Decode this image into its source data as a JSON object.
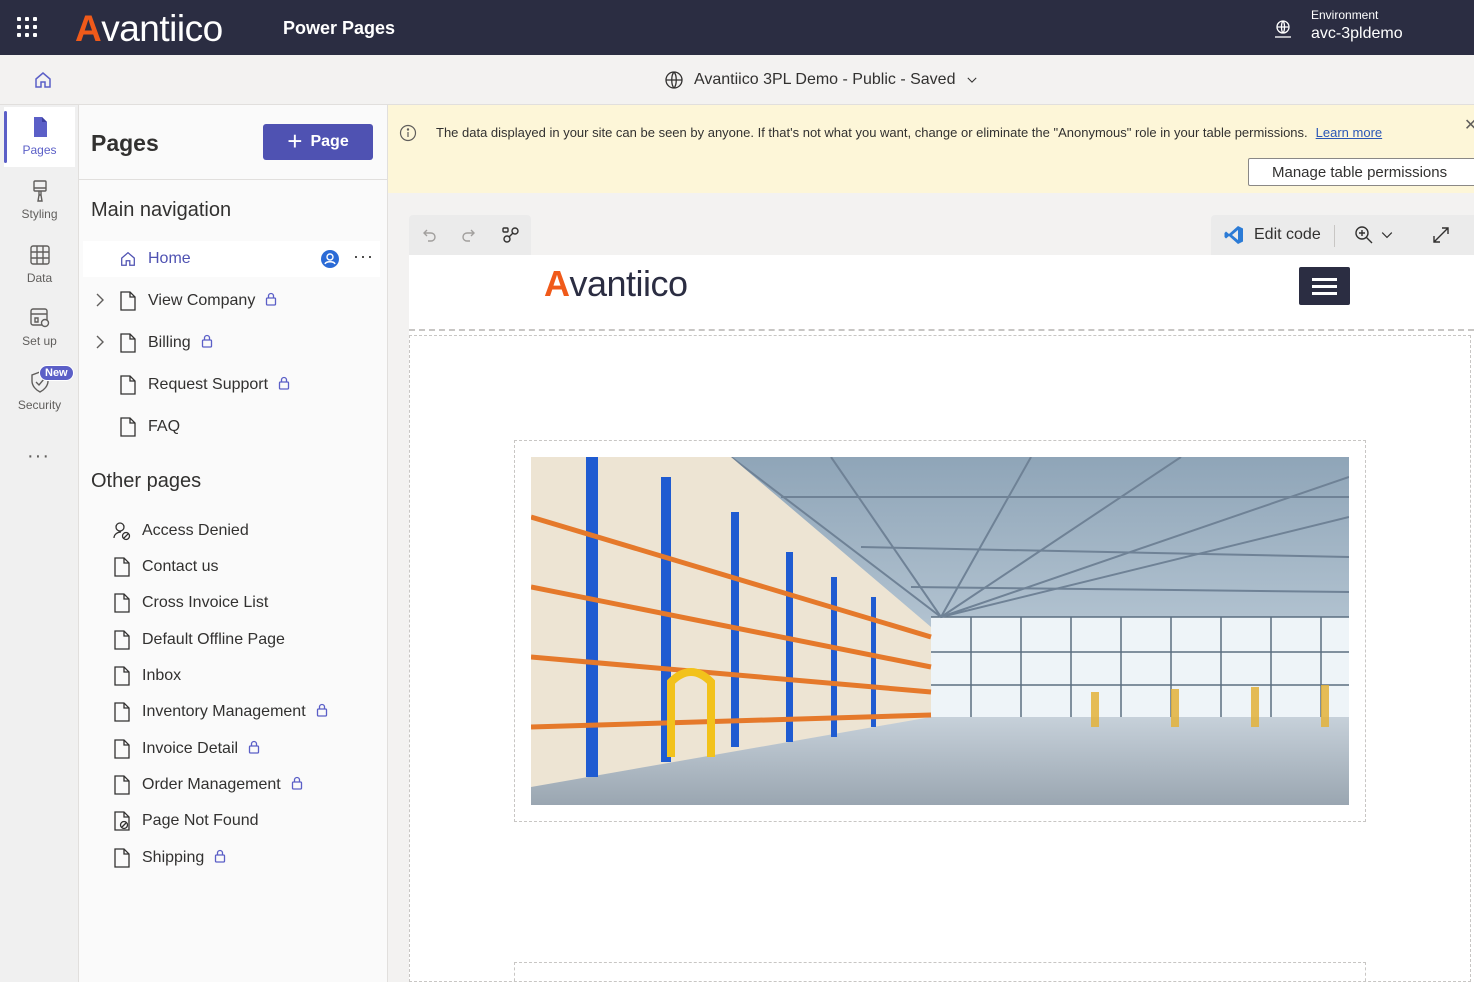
{
  "topbar": {
    "brand_a": "A",
    "brand_rest": "vantiico",
    "product": "Power Pages",
    "env_label": "Environment",
    "env_value": "avc-3pldemo"
  },
  "subbar": {
    "site_title": "Avantiico 3PL Demo - Public - Saved"
  },
  "rail": {
    "items": [
      {
        "label": "Pages",
        "icon": "page-icon",
        "active": true
      },
      {
        "label": "Styling",
        "icon": "paintbrush-icon"
      },
      {
        "label": "Data",
        "icon": "table-icon"
      },
      {
        "label": "Set up",
        "icon": "setup-icon"
      },
      {
        "label": "Security",
        "icon": "shield-icon",
        "badge": "New"
      }
    ],
    "more": "···"
  },
  "panel": {
    "title": "Pages",
    "add_button": "Page",
    "main_nav_title": "Main navigation",
    "main_nav": [
      {
        "label": "Home",
        "selected": true
      },
      {
        "label": "View Company",
        "locked": true,
        "expandable": true
      },
      {
        "label": "Billing",
        "locked": true,
        "expandable": true
      },
      {
        "label": "Request Support",
        "locked": true
      },
      {
        "label": "FAQ"
      }
    ],
    "other_title": "Other pages",
    "other_pages": [
      {
        "label": "Access Denied"
      },
      {
        "label": "Contact us"
      },
      {
        "label": "Cross Invoice List"
      },
      {
        "label": "Default Offline Page"
      },
      {
        "label": "Inbox"
      },
      {
        "label": "Inventory Management",
        "locked": true
      },
      {
        "label": "Invoice Detail",
        "locked": true
      },
      {
        "label": "Order Management",
        "locked": true
      },
      {
        "label": "Page Not Found"
      },
      {
        "label": "Shipping",
        "locked": true
      }
    ],
    "row_more": "···"
  },
  "banner": {
    "text": "The data displayed in your site can be seen by anyone. If that's not what you want, change or eliminate the \"Anonymous\" role in your table permissions.",
    "link": "Learn more",
    "button": "Manage table permissions"
  },
  "toolbar": {
    "edit_code": "Edit code"
  },
  "site": {
    "brand_a": "A",
    "brand_rest": "vantiico"
  },
  "colors": {
    "topbar": "#2b2d42",
    "accent": "#5b5fc7",
    "brand_orange": "#f05a1a",
    "banner": "#fdf6d8"
  }
}
